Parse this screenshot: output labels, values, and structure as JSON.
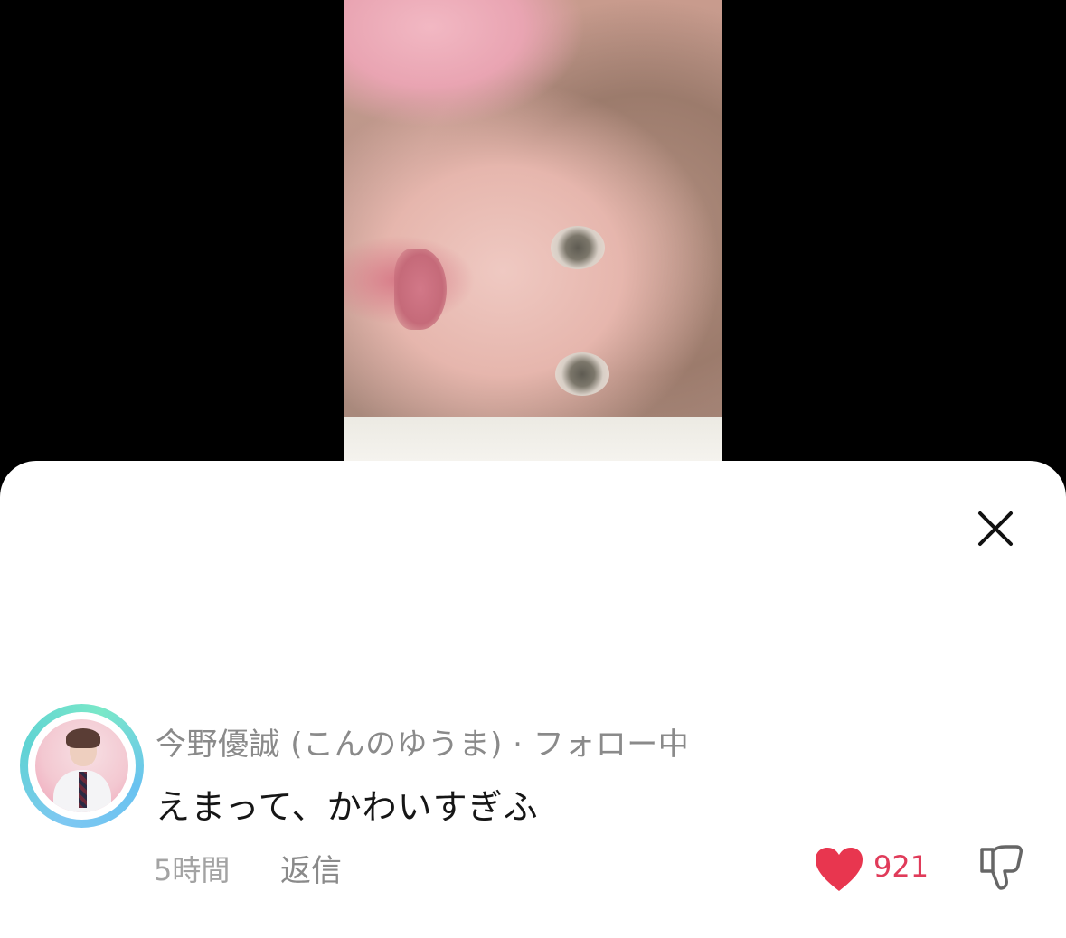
{
  "video": {
    "description_icon": "video-frame"
  },
  "sheet": {
    "close_icon": "close-icon"
  },
  "comment": {
    "username": "今野優誠 (こんのゆうま) · フォロー中",
    "text": "えまって、かわいすぎふ",
    "time": "5時間",
    "reply_label": "返信",
    "like_count": "921",
    "liked": true,
    "like_color": "#e8364f",
    "avatar_ring_colors": [
      "#7ec8f2",
      "#5fd3d3",
      "#7ae8c8"
    ]
  }
}
